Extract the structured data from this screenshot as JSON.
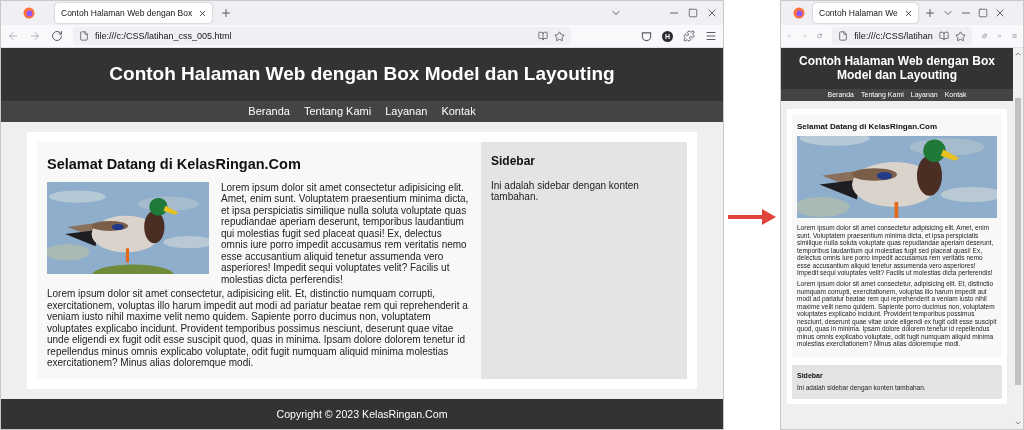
{
  "windows": [
    {
      "kind": "wide",
      "tab_title": "Contoh Halaman Web dengan Box",
      "url": "file:///c:/CSS/latihan_css_005.html",
      "profile_initial": "H",
      "page": {
        "title": "Contoh Halaman Web dengan Box Model dan Layouting",
        "nav": [
          "Beranda",
          "Tentang Kami",
          "Layanan",
          "Kontak"
        ],
        "heading": "Selamat Datang di KelasRingan.Com",
        "paragraphs": [
          "Lorem ipsum dolor sit amet consectetur adipisicing elit. Amet, enim sunt. Voluptatem praesentium minima dicta, et ipsa perspiciatis similique nulla soluta voluptate quas repudiandae aperiam deserunt, temporibus laudantium qui molestias fugit sed placeat quasi! Ex, delectus omnis iure porro impedit accusamus rem veritatis nemo esse accusantium aliquid tenetur assumenda vero asperiores! Impedit sequi voluptates velit? Facilis ut molestias dicta perferendis!",
          "Lorem ipsum dolor sit amet consectetur, adipisicing elit. Et, distinctio numquam corrupti, exercitationem, voluptas illo harum impedit aut modi ad pariatur beatae rem qui reprehenderit a veniam iusto nihil maxime velit nemo quidem. Sapiente porro ducimus non, voluptatem voluptates explicabo incidunt. Provident temporibus possimus nesciunt, deserunt quae vitae unde eligendi ex fugit odit esse suscipit quod, quas in minima. Ipsam dolore dolorem tenetur id repellendus minus omnis explicabo voluptate, odit fugit numquam aliquid minima molestias exercitationem? Minus alias doloremque modi."
        ],
        "sidebar": {
          "heading": "Sidebar",
          "text": "Ini adalah sidebar dengan konten tambahan."
        },
        "footer": "Copyright © 2023 KelasRingan.Com"
      }
    },
    {
      "kind": "narrow",
      "tab_title": "Contoh Halaman We",
      "url": "file:///c:/CSS/latihan",
      "page": {
        "title": "Contoh Halaman Web dengan Box Model dan Layouting",
        "nav": [
          "Beranda",
          "Tentang Kami",
          "Layanan",
          "Kontak"
        ],
        "heading": "Selamat Datang di KelasRingan.Com",
        "paragraphs": [
          "Lorem ipsum dolor sit amet consectetur adipisicing elit. Amet, enim sunt. Voluptatem praesentium minima dicta, et ipsa perspiciatis similique nulla soluta voluptate quas repudiandae aperiam deserunt, temporibus laudantium qui molestias fugit sed placeat quasi! Ex, delectus omnis iure porro impedit accusamus rem veritatis nemo esse accusantium aliquid tenetur assumenda vero asperiores! Impedit sequi voluptates velit? Facilis ut molestias dicta perferendis!",
          "Lorem ipsum dolor sit amet consectetur, adipisicing elit. Et, distinctio numquam corrupti, exercitationem, voluptas illo harum impedit aut modi ad pariatur beatae rem qui reprehenderit a veniam iusto nihil maxime velit nemo quidem. Sapiente porro ducimus non, voluptatem voluptates explicabo incidunt. Provident temporibus possimus nesciunt, deserunt quae vitae unde eligendi ex fugit odit esse suscipit quod, quas in minima. Ipsam dolore dolorem tenetur id repellendus minus omnis explicabo voluptate, odit fugit numquam aliquid minima molestias exercitationem? Minus alias doloremque modi."
        ],
        "sidebar": {
          "heading": "Sidebar",
          "text": "Ini adalah sidebar dengan konten tambahan."
        }
      }
    }
  ]
}
